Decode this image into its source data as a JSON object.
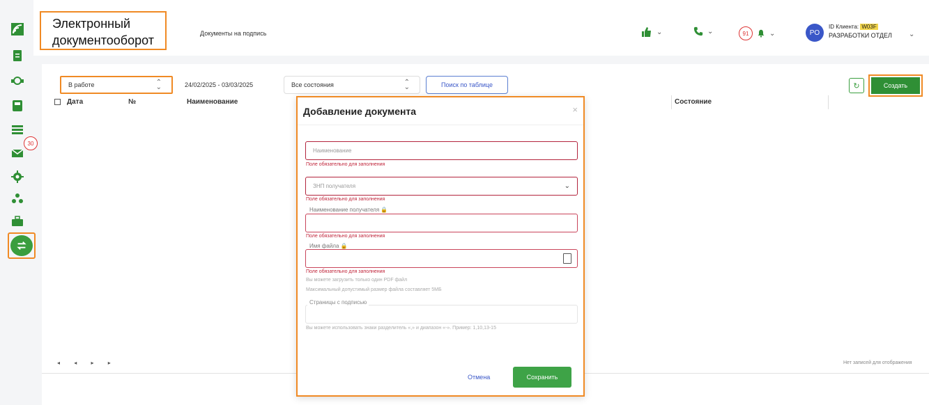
{
  "app": {
    "title": "Электронный документооборот",
    "subtitle": "Документы на подпись"
  },
  "sidebar": {
    "icons": [
      "logo-icon",
      "document-icon",
      "handshake-icon",
      "save-icon",
      "card-icon",
      "mail-icon",
      "gear-icon",
      "people-icon",
      "briefcase-icon",
      "transfer-icon"
    ],
    "mail_badge": "30"
  },
  "header": {
    "notifications_count": "91",
    "avatar_initials": "PO",
    "client_id_label": "ID Клиента:",
    "client_id_value": "W03F",
    "department": "РАЗРАБОТКИ ОТДЕЛ",
    "chevron": "⌄"
  },
  "toolbar": {
    "status_value": "В работе",
    "date_range": "24/02/2025 - 03/03/2025",
    "states_value": "Все состояния",
    "search_label": "Поиск по таблице",
    "refresh_icon": "↻",
    "create_label": "Создать"
  },
  "table": {
    "columns": [
      "Дата",
      "№",
      "Наименование",
      "Состояние"
    ],
    "pager": "◂ ◂ ▸ ▸",
    "no_records": "Нет записей для отображения"
  },
  "modal": {
    "title": "Добавление документа",
    "close": "×",
    "name_placeholder": "Наименование",
    "inn_placeholder": "ЗНП получателя",
    "recipient_label": "Наименование получателя",
    "file_label": "Имя файла",
    "required_error": "Поле обязательно для заполнения",
    "hint_pdf": "Вы можете загрузить только один PDF файл",
    "hint_size": "Максимальный допустимый размер файла составляет 5МБ",
    "pages_label": "Страницы с подписью",
    "pages_hint": "Вы можете использовать знаки разделитель «,» и диапазон «-». Пример: 1,10,13-15",
    "cancel_label": "Отмена",
    "save_label": "Сохранить"
  },
  "colors": {
    "accent_green": "#2f8f35",
    "highlight_orange": "#f08a24",
    "error_red": "#c0243a",
    "link_blue": "#3a57c8"
  }
}
